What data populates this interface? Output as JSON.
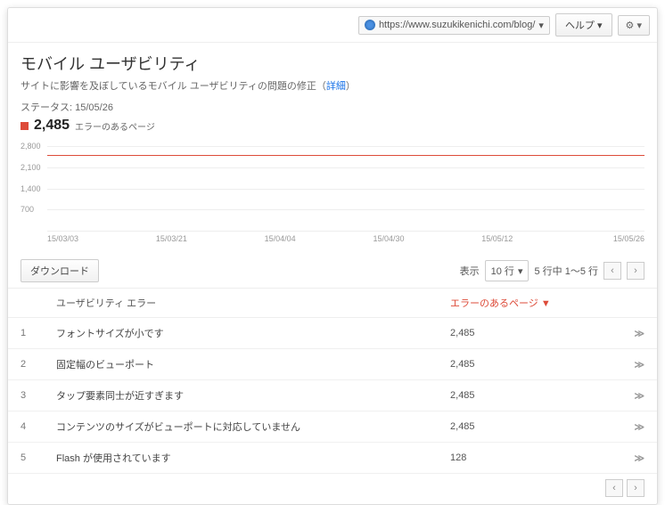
{
  "topbar": {
    "url": "https://www.suzukikenichi.com/blog/",
    "help": "ヘルプ"
  },
  "header": {
    "title": "モバイル ユーザビリティ",
    "subtitle_pre": "サイトに影響を及ぼしているモバイル ユーザビリティの問題の修正（",
    "subtitle_link": "詳細",
    "subtitle_post": "）",
    "status": "ステータス: 15/05/26",
    "count": "2,485",
    "count_label": "エラーのあるページ"
  },
  "chart_data": {
    "type": "line",
    "y_ticks": [
      "2,800",
      "2,100",
      "1,400",
      "700"
    ],
    "x_ticks": [
      "15/03/03",
      "15/03/21",
      "15/04/04",
      "15/04/30",
      "15/05/12",
      "15/05/26"
    ],
    "series": [
      {
        "name": "errors",
        "approx_value": 2485,
        "ylim": [
          0,
          2800
        ]
      }
    ]
  },
  "controls": {
    "download": "ダウンロード",
    "show_label": "表示",
    "rows": "10 行",
    "range": "5 行中 1〜5 行"
  },
  "table": {
    "col_error": "ユーザビリティ エラー",
    "col_pages": "エラーのあるページ ▼",
    "rows": [
      {
        "idx": "1",
        "err": "フォントサイズが小です",
        "val": "2,485"
      },
      {
        "idx": "2",
        "err": "固定幅のビューポート",
        "val": "2,485"
      },
      {
        "idx": "3",
        "err": "タップ要素同士が近すぎます",
        "val": "2,485"
      },
      {
        "idx": "4",
        "err": "コンテンツのサイズがビューポートに対応していません",
        "val": "2,485"
      },
      {
        "idx": "5",
        "err": "Flash が使用されています",
        "val": "128"
      }
    ]
  }
}
